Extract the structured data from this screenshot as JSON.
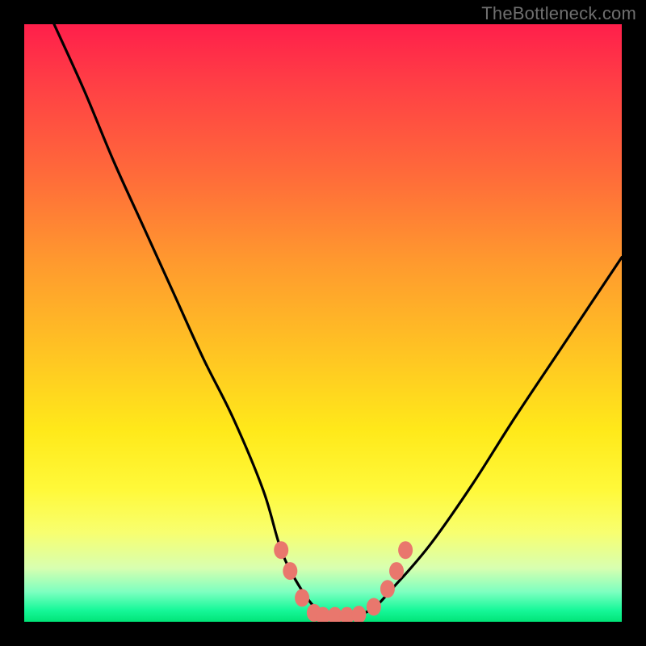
{
  "watermark": "TheBottleneck.com",
  "chart_data": {
    "type": "line",
    "title": "",
    "xlabel": "",
    "ylabel": "",
    "xlim": [
      0,
      100
    ],
    "ylim": [
      0,
      100
    ],
    "series": [
      {
        "name": "bottleneck-curve",
        "x": [
          5,
          10,
          15,
          20,
          25,
          30,
          35,
          40,
          43,
          46,
          49,
          51,
          54,
          58,
          62,
          68,
          75,
          82,
          90,
          100
        ],
        "values": [
          100,
          89,
          77,
          66,
          55,
          44,
          34,
          22,
          12,
          6,
          2,
          1,
          1,
          2,
          6,
          13,
          23,
          34,
          46,
          61
        ]
      }
    ],
    "markers": {
      "name": "highlight-dots",
      "color": "#e9776d",
      "points": [
        {
          "x": 43.0,
          "y": 12.0
        },
        {
          "x": 44.5,
          "y": 8.5
        },
        {
          "x": 46.5,
          "y": 4.0
        },
        {
          "x": 48.5,
          "y": 1.5
        },
        {
          "x": 50.0,
          "y": 1.0
        },
        {
          "x": 52.0,
          "y": 1.0
        },
        {
          "x": 54.0,
          "y": 1.0
        },
        {
          "x": 56.0,
          "y": 1.2
        },
        {
          "x": 58.5,
          "y": 2.5
        },
        {
          "x": 60.8,
          "y": 5.5
        },
        {
          "x": 62.3,
          "y": 8.5
        },
        {
          "x": 63.8,
          "y": 12.0
        }
      ]
    },
    "background_gradient": {
      "top": "#ff1f4b",
      "mid": "#ffe91a",
      "bottom": "#00e477"
    }
  }
}
